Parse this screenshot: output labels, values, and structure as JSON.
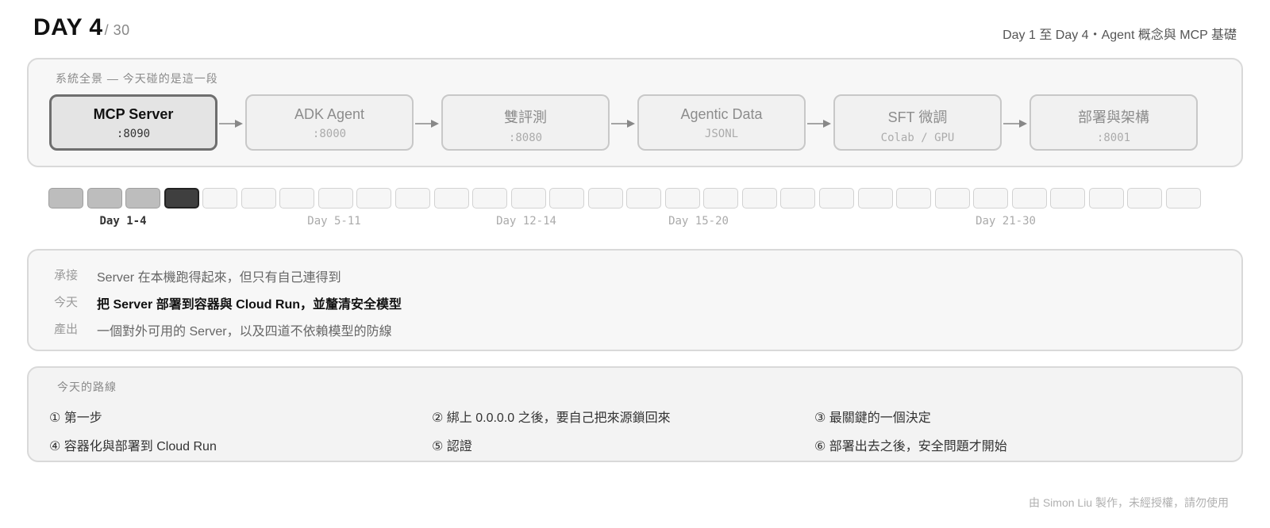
{
  "header": {
    "day": "DAY 4",
    "total": "/ 30",
    "subtitle": "Day 1 至 Day 4・Agent 概念與 MCP 基礎"
  },
  "overview": {
    "label": "系統全景 — 今天碰的是這一段",
    "nodes": [
      {
        "title": "MCP Server",
        "sub": ":8090",
        "active": true
      },
      {
        "title": "ADK Agent",
        "sub": ":8000",
        "active": false
      },
      {
        "title": "雙評測",
        "sub": ":8080",
        "active": false
      },
      {
        "title": "Agentic Data",
        "sub": "JSONL",
        "active": false
      },
      {
        "title": "SFT 微調",
        "sub": "Colab / GPU",
        "active": false
      },
      {
        "title": "部署與架構",
        "sub": ":8001",
        "active": false
      }
    ]
  },
  "timeline": {
    "total_days": 30,
    "current_day": 4,
    "labels": [
      "Day 1-4",
      "Day 5-11",
      "Day 12-14",
      "Day 15-20",
      "Day 21-30"
    ]
  },
  "context": {
    "rows": [
      {
        "key": "承接",
        "value": "Server 在本機跑得起來，但只有自己連得到"
      },
      {
        "key": "今天",
        "value": "把 Server 部署到容器與 Cloud Run，並釐清安全模型"
      },
      {
        "key": "產出",
        "value": "一個對外可用的 Server，以及四道不依賴模型的防線"
      }
    ]
  },
  "route": {
    "label": "今天的路線",
    "items": [
      "① 第一步",
      "② 綁上 0.0.0.0 之後，要自己把來源鎖回來",
      "③ 最關鍵的一個決定",
      "④ 容器化與部署到 Cloud Run",
      "⑤ 認證",
      "⑥ 部署出去之後，安全問題才開始"
    ]
  },
  "footer": "由 Simon Liu 製作，未經授權，請勿使用",
  "colors": {
    "active_node_border": "#6e6e6e",
    "done_cell": "#bdbdbd",
    "current_cell": "#3f3f3f"
  }
}
